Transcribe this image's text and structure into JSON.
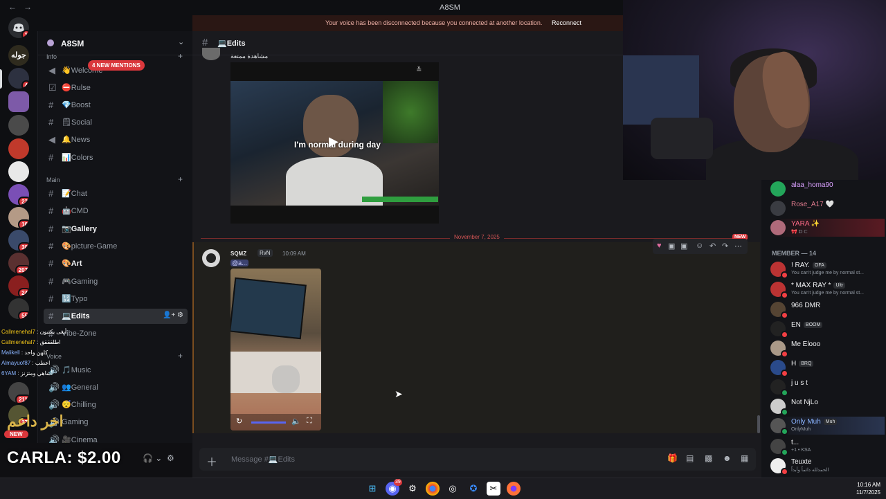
{
  "window": {
    "title": "A8SM",
    "back": "←",
    "forward": "→"
  },
  "voice_banner": {
    "message": "Your voice has been disconnected because you connected at another location.",
    "reconnect": "Reconnect"
  },
  "server": {
    "name": "A8SM"
  },
  "mentions_badge": "4 NEW MENTIONS",
  "rail_badges": [
    "1",
    "4",
    "23",
    "16",
    "30",
    "207",
    "24",
    "55",
    "211",
    "27"
  ],
  "categories": {
    "info": "Info",
    "main": "Main",
    "voice": "Voice"
  },
  "channels": [
    {
      "label": "👋Welcome",
      "icon": "announcement"
    },
    {
      "label": "⛔Rulse",
      "icon": "rules"
    },
    {
      "label": "💎Boost",
      "icon": "hash"
    },
    {
      "label": "🗒Social",
      "icon": "hash"
    },
    {
      "label": "🔔News",
      "icon": "announcement"
    },
    {
      "label": "📊Colors",
      "icon": "hash"
    },
    {
      "label": "📝Chat",
      "icon": "hash"
    },
    {
      "label": "🤖CMD",
      "icon": "hash"
    },
    {
      "label": "📷Gallery",
      "icon": "hash"
    },
    {
      "label": "🎨picture-Game",
      "icon": "hash"
    },
    {
      "label": "🎨Art",
      "icon": "hash"
    },
    {
      "label": "🎮Gaming",
      "icon": "hash"
    },
    {
      "label": "🔢Typo",
      "icon": "hash"
    },
    {
      "label": "💻Edits",
      "icon": "hash"
    },
    {
      "label": "Vibe-Zone",
      "icon": "hash"
    },
    {
      "label": "🎵Music",
      "icon": "speaker"
    },
    {
      "label": "👥General",
      "icon": "speaker"
    },
    {
      "label": "😴Chilling",
      "icon": "speaker"
    },
    {
      "label": "Gaming",
      "icon": "speaker"
    },
    {
      "label": "🎥Cinema",
      "icon": "speaker"
    }
  ],
  "chat": {
    "channel": "💻Edits",
    "first_msg_text": "مشاهدة ممتعة",
    "video_caption": "I'm normal during day",
    "date_divider": "November 7, 2025",
    "new_tag": "NEW",
    "msg2": {
      "user": "SQMZ",
      "tag": "RvN",
      "time": "10:09 AM",
      "mention": "@a..."
    },
    "composer_placeholder": "Message #💻Edits"
  },
  "members": {
    "online_top": [
      {
        "name": "alaa_homa90",
        "color": "#d9a0ff"
      },
      {
        "name": "Rose_A17 🤍",
        "color": "#e07b8e"
      },
      {
        "name": "YARA ✨",
        "color": "#ff6b88",
        "status": "🎀 ᗪ ᑕ"
      }
    ],
    "header": "MEMBER — 14",
    "list": [
      {
        "name": "! RAY.",
        "tag": "OFA",
        "status": "You can't judge me by normal st...",
        "dot": "#f23f43"
      },
      {
        "name": "* MAX RAY *",
        "tag": "Ultr",
        "status": "You can't judge me by normal st...",
        "dot": "#f23f43"
      },
      {
        "name": "966 DMR",
        "tag": "",
        "status": "",
        "dot": "#f23f43"
      },
      {
        "name": "EN",
        "tag": "BOOM",
        "status": "",
        "dot": "#f23f43"
      },
      {
        "name": "Me Elooo",
        "tag": "",
        "status": "",
        "dot": "#f23f43"
      },
      {
        "name": "H",
        "tag": "BRQ",
        "status": "",
        "dot": "#f23f43"
      },
      {
        "name": "j u s t",
        "tag": "",
        "status": "",
        "dot": "#23a55a"
      },
      {
        "name": "Not NjLo",
        "tag": "",
        "status": "",
        "dot": "#23a55a"
      },
      {
        "name": "Only Muh",
        "tag": "Muh",
        "status": "OnlyMuh",
        "dot": "#23a55a",
        "color": "#8ab4ff"
      },
      {
        "name": "t...",
        "tag": "",
        "status": "+1 • KSA",
        "dot": "#23a55a"
      },
      {
        "name": "Teuxte",
        "tag": "",
        "status": "الحمدلله دائماً وأبداً",
        "dot": "#f23f43"
      }
    ]
  },
  "overlay": {
    "donation": "CARLA: $2.00",
    "arabic_big": "اخر داعم",
    "new_badge": "NEW",
    "feed": [
      {
        "user": "Callmenehal7",
        "text": "أبغى يكتبون"
      },
      {
        "user": "Callmenehal7",
        "text": "اطلقققق"
      },
      {
        "user": "Malikell",
        "text": "كلهن واحد"
      },
      {
        "user": "Almayuof87",
        "text": "اعطب"
      },
      {
        "user": "6YAM",
        "text": "أشاهي ومتزنز"
      }
    ]
  },
  "taskbar": {
    "time": "10:16 AM",
    "date": "11/7/2025",
    "discord_badge": "39"
  }
}
